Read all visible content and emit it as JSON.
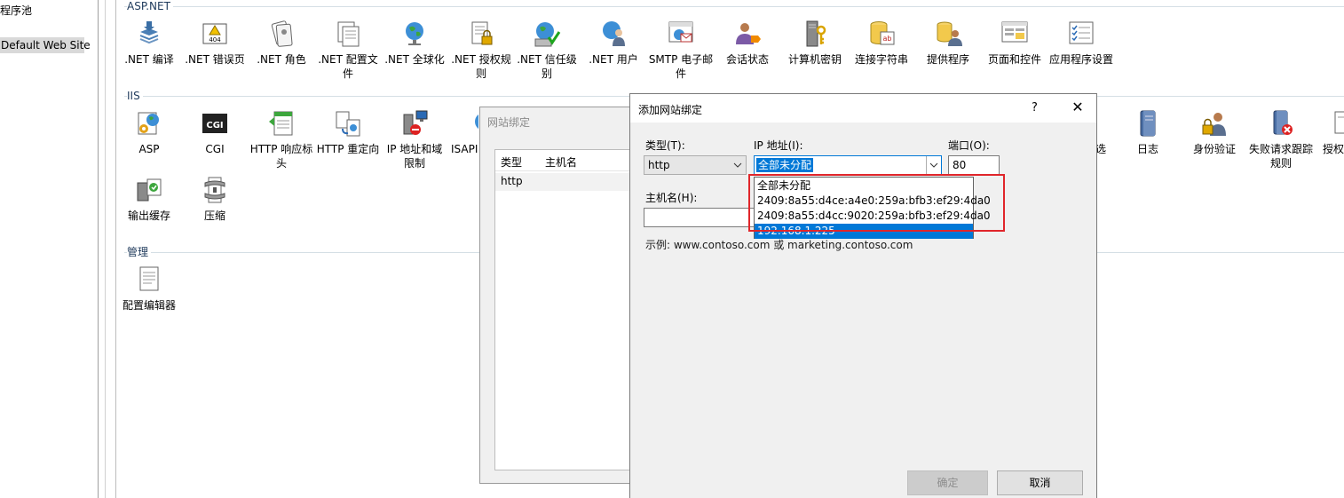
{
  "tree": {
    "items": [
      {
        "label": "程序池"
      },
      {
        "label": "Default Web Site"
      }
    ]
  },
  "sections": {
    "aspnet": {
      "title": "ASP.NET",
      "tiles": [
        {
          "label": ".NET 编译",
          "icon": "net-compile-icon"
        },
        {
          "label": ".NET 错误页",
          "icon": "net-error-page-icon"
        },
        {
          "label": ".NET 角色",
          "icon": "net-roles-icon"
        },
        {
          "label": ".NET 配置文件",
          "icon": "net-profile-icon"
        },
        {
          "label": ".NET 全球化",
          "icon": "net-globalization-icon"
        },
        {
          "label": ".NET 授权规则",
          "icon": "net-authorization-icon"
        },
        {
          "label": ".NET 信任级别",
          "icon": "net-trust-level-icon"
        },
        {
          "label": ".NET 用户",
          "icon": "net-users-icon"
        },
        {
          "label": "SMTP 电子邮件",
          "icon": "smtp-email-icon"
        },
        {
          "label": "会话状态",
          "icon": "session-state-icon"
        },
        {
          "label": "计算机密钥",
          "icon": "machine-key-icon"
        },
        {
          "label": "连接字符串",
          "icon": "connection-strings-icon"
        },
        {
          "label": "提供程序",
          "icon": "providers-icon"
        },
        {
          "label": "页面和控件",
          "icon": "pages-controls-icon"
        },
        {
          "label": "应用程序设置",
          "icon": "app-settings-icon"
        }
      ]
    },
    "iis": {
      "title": "IIS",
      "tiles": [
        {
          "label": "ASP",
          "icon": "asp-icon"
        },
        {
          "label": "CGI",
          "icon": "cgi-icon"
        },
        {
          "label": "HTTP 响应标头",
          "icon": "http-response-headers-icon"
        },
        {
          "label": "HTTP 重定向",
          "icon": "http-redirect-icon"
        },
        {
          "label": "IP 地址和域限制",
          "icon": "ip-restrictions-icon"
        },
        {
          "label": "ISAPI",
          "icon": "isapi-icon"
        },
        {
          "label": "输出缓存",
          "icon": "output-cache-icon"
        },
        {
          "label": "压缩",
          "icon": "compression-icon"
        }
      ],
      "right_tiles": [
        {
          "label": "选",
          "icon": "partial-icon"
        },
        {
          "label": "日志",
          "icon": "logging-icon"
        },
        {
          "label": "身份验证",
          "icon": "authentication-icon"
        },
        {
          "label": "失败请求跟踪规则",
          "icon": "failed-request-tracing-icon"
        },
        {
          "label": "授权",
          "icon": "authorization-icon"
        }
      ]
    },
    "management": {
      "title": "管理",
      "tiles": [
        {
          "label": "配置编辑器",
          "icon": "configuration-editor-icon"
        }
      ]
    }
  },
  "site_bindings_dialog": {
    "title": "网站绑定",
    "columns": [
      "类型",
      "主机名"
    ],
    "rows": [
      {
        "type": "http"
      }
    ]
  },
  "add_binding_dialog": {
    "title": "添加网站绑定",
    "help": "?",
    "close": "✕",
    "type_label": "类型(T):",
    "type_value": "http",
    "ip_label": "IP 地址(I):",
    "ip_value": "全部未分配",
    "port_label": "端口(O):",
    "port_value": "80",
    "host_label": "主机名(H):",
    "host_value": "",
    "example": "示例: www.contoso.com 或 marketing.contoso.com",
    "ip_options": [
      "全部未分配",
      "2409:8a55:d4ce:a4e0:259a:bfb3:ef29:4da0",
      "2409:8a55:d4cc:9020:259a:bfb3:ef29:4da0",
      "192.168.1.225"
    ],
    "ok_label": "确定",
    "cancel_label": "取消"
  }
}
